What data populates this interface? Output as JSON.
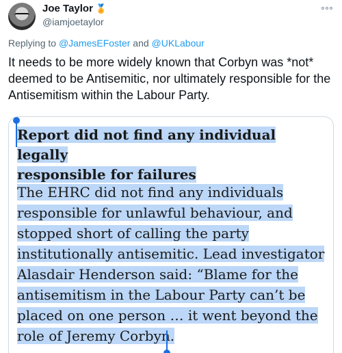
{
  "author": {
    "display_name": "Joe Taylor",
    "emoji": "🏅",
    "handle": "@iamjoetaylor"
  },
  "replying": {
    "prefix": "Replying to",
    "mention1": "@JamesEFoster",
    "conjunction": "and",
    "mention2": "@UKLabour"
  },
  "tweet": {
    "text": "It needs to be more widely known that Corbyn was *not* deemed to be Antisemitic, nor ultimately responsible for the Antisemitism within the Labour Party."
  },
  "article": {
    "title_line1": "Report did not find any individual legally",
    "title_line2": "responsible for failures",
    "body_lines": [
      "The EHRC did not find any individuals",
      "responsible for unlawful behaviour, and",
      "stopped short of calling the party",
      "institutionally antisemitic. Lead investigator",
      "Alasdair Henderson said: “Blame for the",
      "antisemitism in the Labour Party can’t be",
      "placed on one person … it went beyond the",
      "role of Jeremy Corbyn."
    ]
  },
  "colors": {
    "accent": "#1d9bf0",
    "selection": "#bcd7f7",
    "text": "#0f1419",
    "secondary": "#536471"
  },
  "icons": {
    "more": "more-options-icon",
    "avatar": "avatar"
  }
}
